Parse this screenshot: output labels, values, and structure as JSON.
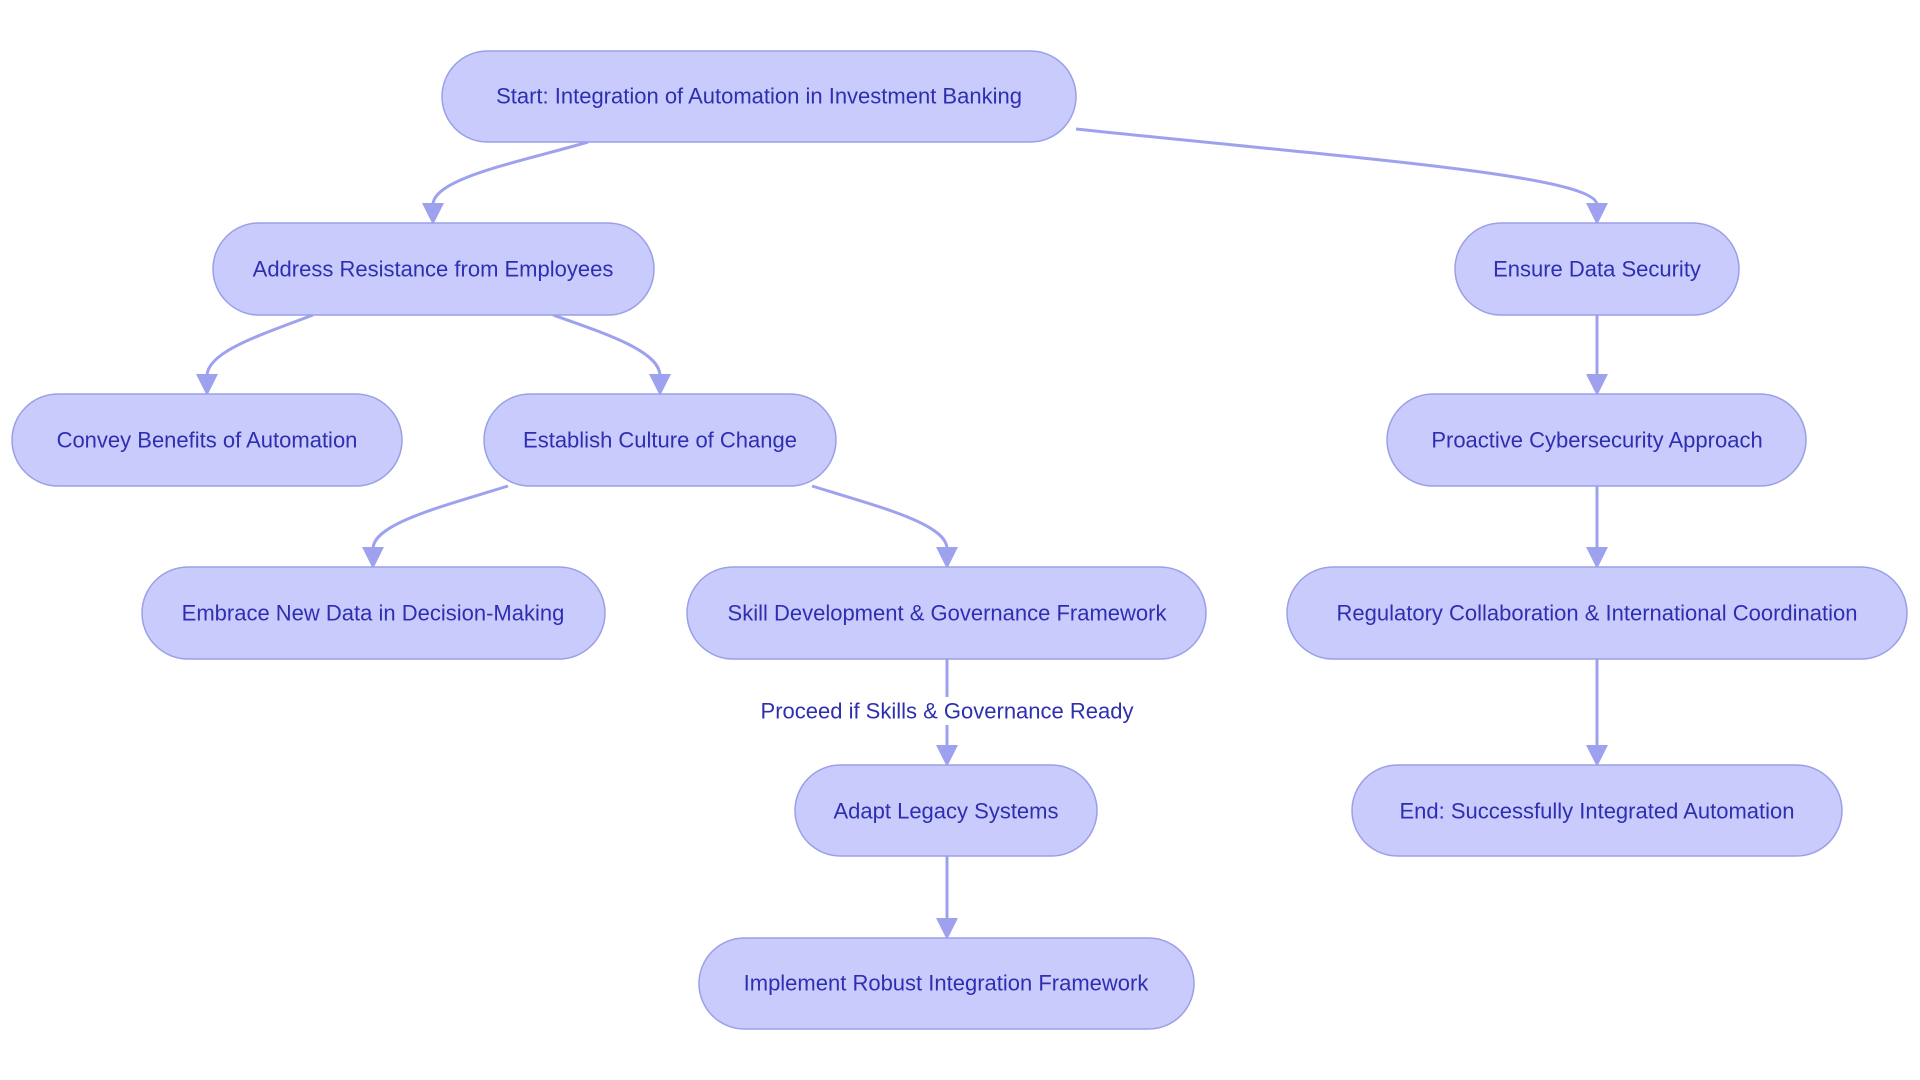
{
  "colors": {
    "node_fill": "#c9cbfd",
    "node_stroke": "#9b9fe6",
    "text": "#2e2fb0",
    "edge": "#9ea2ee"
  },
  "nodes": {
    "start": "Start: Integration of Automation in Investment Banking",
    "resistance": "Address Resistance from Employees",
    "security": "Ensure Data Security",
    "benefits": "Convey Benefits of Automation",
    "culture": "Establish Culture of Change",
    "cyber": "Proactive Cybersecurity Approach",
    "data": "Embrace New Data in Decision-Making",
    "skill": "Skill Development & Governance Framework",
    "regulatory": "Regulatory Collaboration & International Coordination",
    "legacy": "Adapt Legacy Systems",
    "end": "End: Successfully Integrated Automation",
    "implement": "Implement Robust Integration Framework"
  },
  "edge_labels": {
    "skill_to_legacy": "Proceed if Skills & Governance Ready"
  }
}
